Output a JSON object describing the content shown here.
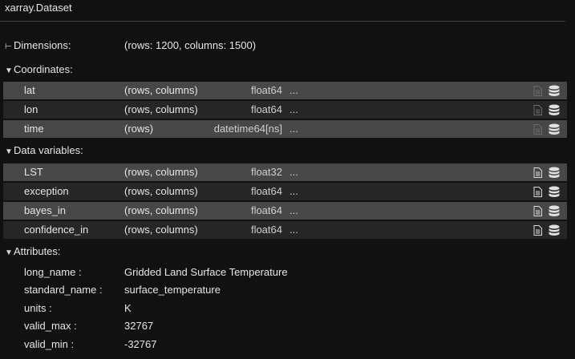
{
  "header": {
    "title": "xarray.Dataset"
  },
  "dimensions": {
    "label": "Dimensions:",
    "value": "(rows: 1200, columns: 1500)"
  },
  "coordinates": {
    "label": "Coordinates:",
    "items": [
      {
        "name": "lat",
        "dims": "(rows, columns)",
        "dtype": "float64",
        "preview": "..."
      },
      {
        "name": "lon",
        "dims": "(rows, columns)",
        "dtype": "float64",
        "preview": "..."
      },
      {
        "name": "time",
        "dims": "(rows)",
        "dtype": "datetime64[ns]",
        "preview": "..."
      }
    ]
  },
  "data_variables": {
    "label": "Data variables:",
    "items": [
      {
        "name": "LST",
        "dims": "(rows, columns)",
        "dtype": "float32",
        "preview": "..."
      },
      {
        "name": "exception",
        "dims": "(rows, columns)",
        "dtype": "float64",
        "preview": "..."
      },
      {
        "name": "bayes_in",
        "dims": "(rows, columns)",
        "dtype": "float64",
        "preview": "..."
      },
      {
        "name": "confidence_in",
        "dims": "(rows, columns)",
        "dtype": "float64",
        "preview": "..."
      }
    ]
  },
  "attributes": {
    "label": "Attributes:",
    "items": [
      {
        "key": "long_name :",
        "value": "Gridded Land Surface Temperature"
      },
      {
        "key": "standard_name :",
        "value": "surface_temperature"
      },
      {
        "key": "units :",
        "value": "K"
      },
      {
        "key": "valid_max :",
        "value": "32767"
      },
      {
        "key": "valid_min :",
        "value": "-32767"
      }
    ]
  },
  "icons": {
    "dimensions_arrow": "dash-arrow-icon",
    "section_arrow": "triangle-down-icon",
    "attrs": "document-icon",
    "data": "database-icon"
  },
  "colors": {
    "background": "#111111",
    "row_odd": "#474747",
    "row_even": "#262626",
    "text": "#e6e6e6"
  }
}
